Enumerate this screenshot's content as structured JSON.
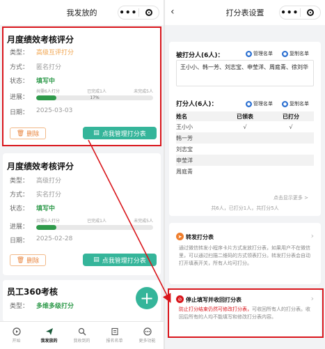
{
  "left": {
    "title": "我发放的",
    "cards": [
      {
        "title": "月度绩效考核评分",
        "rows": [
          {
            "label": "类型：",
            "value": "高级互评打分"
          },
          {
            "label": "方式：",
            "value": "匿名打分"
          },
          {
            "label": "状态：",
            "value": "填写中"
          }
        ],
        "progress_label": "进展：",
        "progress": {
          "total": "共需6人打分",
          "done": "已完成1人",
          "todo": "未完成5人",
          "pct_text": "17%",
          "fraction": 0.17
        },
        "date_label": "日期：",
        "date": "2025-03-03",
        "delete_label": "删除",
        "manage_label": "点我管理打分表"
      },
      {
        "title": "月度绩效考核评分",
        "rows": [
          {
            "label": "类型：",
            "value": "高级打分"
          },
          {
            "label": "方式：",
            "value": "实名打分"
          },
          {
            "label": "状态：",
            "value": "填写中"
          }
        ],
        "progress_label": "进展：",
        "progress": {
          "total": "共需6人打分",
          "done": "已完成1人",
          "todo": "未完成5人",
          "pct_text": "",
          "fraction": 0.17
        },
        "date_label": "日期：",
        "date": "2025-02-28",
        "delete_label": "删除",
        "manage_label": "点我管理打分表"
      },
      {
        "title": "员工360考核",
        "rows": [
          {
            "label": "类型：",
            "value": "多维多级打分"
          }
        ]
      }
    ],
    "fab": "+",
    "tabs": [
      {
        "label": "开始",
        "icon": "play-icon"
      },
      {
        "label": "我发放的",
        "icon": "send-icon"
      },
      {
        "label": "我收到的",
        "icon": "search-icon"
      },
      {
        "label": "报名名单",
        "icon": "list-icon"
      },
      {
        "label": "更多功能",
        "icon": "more-icon"
      }
    ]
  },
  "right": {
    "title": "打分表设置",
    "scored": {
      "header": "被打分人(6人)：",
      "manage": "管理名单",
      "copy": "复制名单",
      "names": "王小小、韩一芳、刘志宝、申莹洋、周庭青、徐刘华"
    },
    "scorers": {
      "header": "打分人(6人)：",
      "manage": "管理名单",
      "copy": "复制名单",
      "columns": [
        "姓名",
        "已领表",
        "已打分"
      ],
      "rows": [
        {
          "name": "王小小",
          "received": "√",
          "scored": "√"
        },
        {
          "name": "韩一芳",
          "received": "",
          "scored": ""
        },
        {
          "name": "刘志宝",
          "received": "",
          "scored": ""
        },
        {
          "name": "申莹洋",
          "received": "",
          "scored": ""
        },
        {
          "name": "周庭青",
          "received": "",
          "scored": ""
        }
      ],
      "more": "点击显示更多 >",
      "summary": "共6人，已打分1人，共打分5人"
    },
    "forward": {
      "title": "转发打分表",
      "desc": "通过微信转发小程序卡片方式发放打分表，如果用户不在微信里，可以通过扫描二维码的方式领表打分。转发打分表会自动打开填表开关，所有人均可打分。"
    },
    "stop": {
      "title": "停止填写并收回打分表",
      "desc_red": "防止打分结束仍然可修改打分表，",
      "desc_rest": "可收回所有人的打分表。收回后所有的人均不能填写和修改打分表内容。"
    }
  },
  "colors": {
    "accent": "#35b59a",
    "status_green": "#2f9a4b",
    "type_orange": "#f0a24a",
    "highlight_red": "#d9151b"
  }
}
